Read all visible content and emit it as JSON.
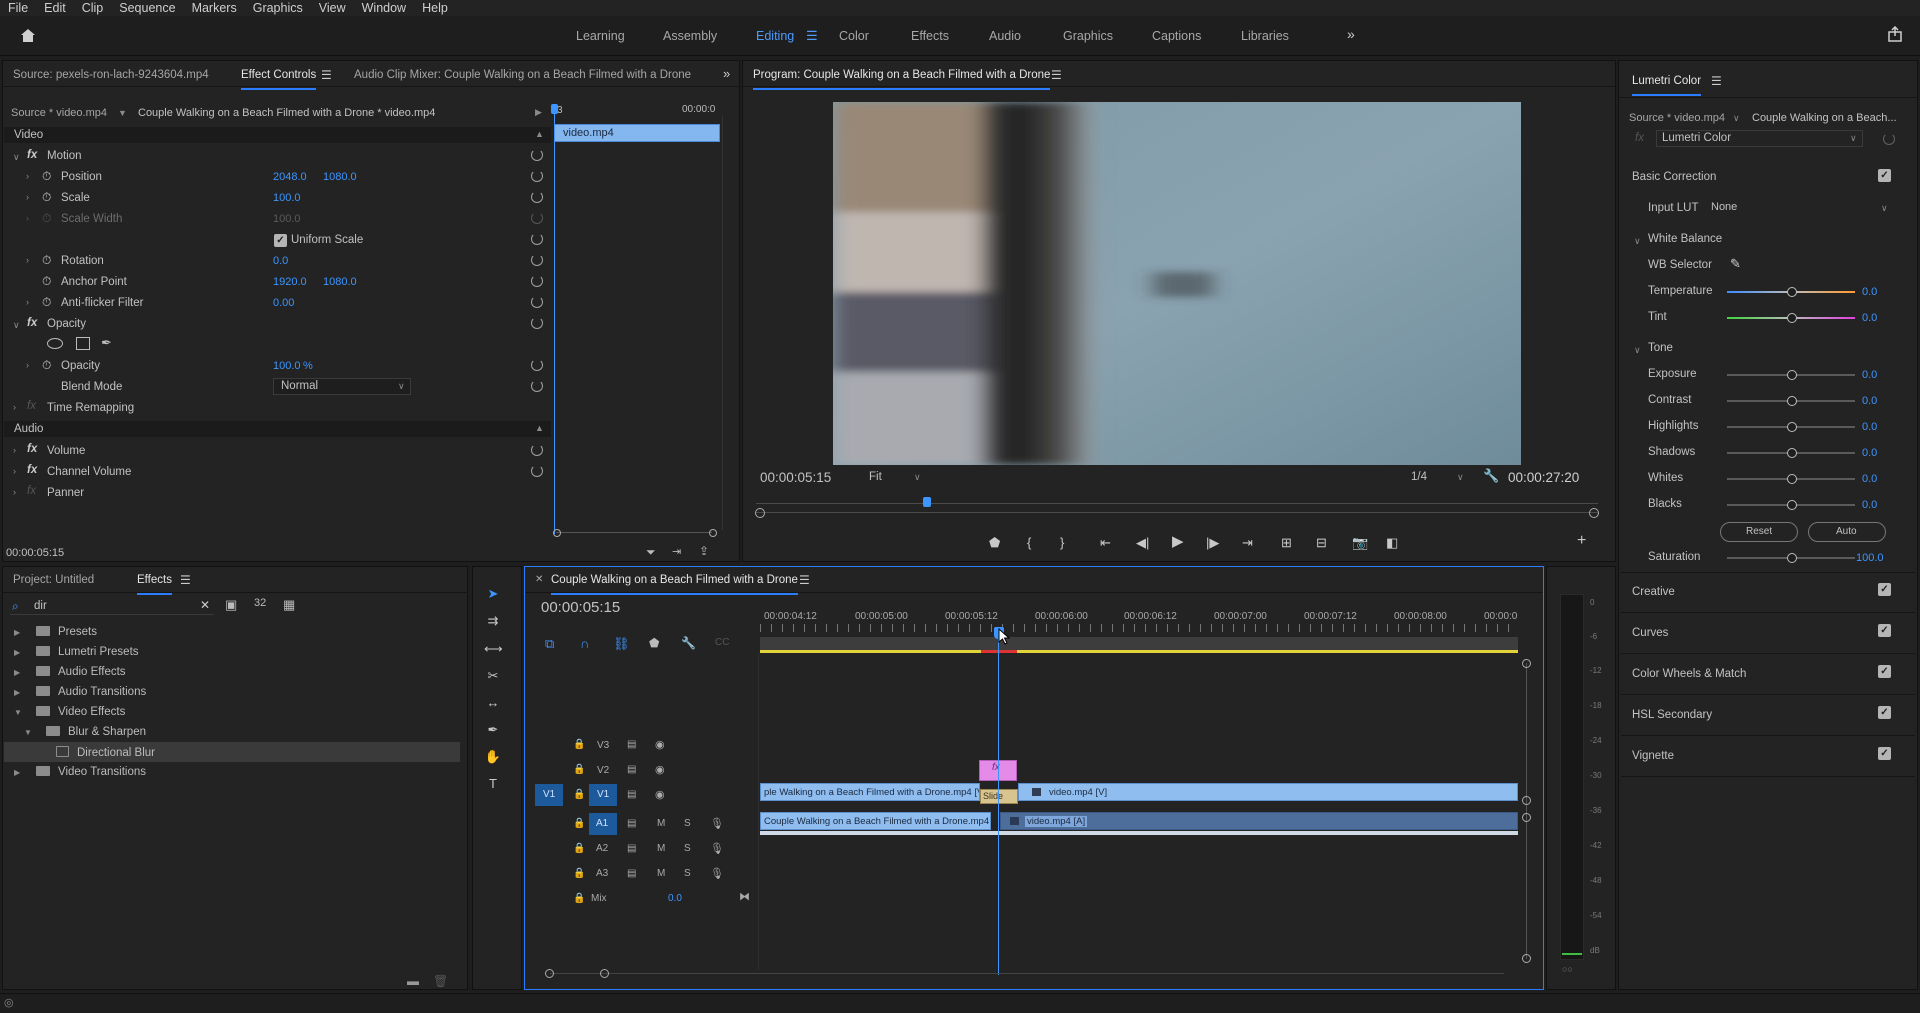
{
  "menu": [
    "File",
    "Edit",
    "Clip",
    "Sequence",
    "Markers",
    "Graphics",
    "View",
    "Window",
    "Help"
  ],
  "workspaces": [
    "Learning",
    "Assembly",
    "Editing",
    "Color",
    "Effects",
    "Audio",
    "Graphics",
    "Captions",
    "Libraries"
  ],
  "source_panel": {
    "source_tab": "Source: pexels-ron-lach-9243604.mp4",
    "effect_controls_tab": "Effect Controls",
    "audio_mixer_tab": "Audio Clip Mixer: Couple Walking on a Beach Filmed with a Drone",
    "source_path": "Source * video.mp4",
    "sequence_path": "Couple Walking on a Beach Filmed with a Drone * video.mp4",
    "mini_time": "00:00:0",
    "mini_clip": "video.mp4",
    "mini_start": "3",
    "timecode": "00:00:05:15"
  },
  "effects": {
    "video_header": "Video",
    "motion": "Motion",
    "position_label": "Position",
    "position_x": "2048.0",
    "position_y": "1080.0",
    "scale_label": "Scale",
    "scale_val": "100.0",
    "scale_width_label": "Scale Width",
    "scale_width_val": "100.0",
    "uniform_label": "Uniform Scale",
    "rotation_label": "Rotation",
    "rotation_val": "0.0",
    "anchor_label": "Anchor Point",
    "anchor_x": "1920.0",
    "anchor_y": "1080.0",
    "flicker_label": "Anti-flicker Filter",
    "flicker_val": "0.00",
    "opacity_header": "Opacity",
    "opacity_label": "Opacity",
    "opacity_val": "100.0",
    "opacity_unit": "%",
    "blend_label": "Blend Mode",
    "blend_val": "Normal",
    "time_remap": "Time Remapping",
    "audio_header": "Audio",
    "volume": "Volume",
    "channel_volume": "Channel Volume",
    "panner": "Panner"
  },
  "program": {
    "title": "Program: Couple Walking on a Beach Filmed with a Drone",
    "timecode": "00:00:05:15",
    "fit": "Fit",
    "resolution": "1/4",
    "duration": "00:00:27:20"
  },
  "lumetri": {
    "title": "Lumetri Color",
    "source": "Source * video.mp4",
    "sequence": "Couple Walking on a Beach...",
    "effect": "Lumetri Color",
    "basic": "Basic Correction",
    "input_lut_label": "Input LUT",
    "input_lut_val": "None",
    "white_balance": "White Balance",
    "wb_selector": "WB Selector",
    "temperature": "Temperature",
    "temperature_val": "0.0",
    "tint": "Tint",
    "tint_val": "0.0",
    "tone": "Tone",
    "exposure": "Exposure",
    "exposure_val": "0.0",
    "contrast": "Contrast",
    "contrast_val": "0.0",
    "highlights": "Highlights",
    "highlights_val": "0.0",
    "shadows": "Shadows",
    "shadows_val": "0.0",
    "whites": "Whites",
    "whites_val": "0.0",
    "blacks": "Blacks",
    "blacks_val": "0.0",
    "reset": "Reset",
    "auto": "Auto",
    "saturation": "Saturation",
    "saturation_val": "100.0",
    "creative": "Creative",
    "curves": "Curves",
    "color_wheels": "Color Wheels & Match",
    "hsl": "HSL Secondary",
    "vignette": "Vignette"
  },
  "project": {
    "project_tab": "Project: Untitled",
    "effects_tab": "Effects",
    "search": "dir",
    "items": [
      "Presets",
      "Lumetri Presets",
      "Audio Effects",
      "Audio Transitions",
      "Video Effects",
      "Blur & Sharpen",
      "Directional Blur",
      "Video Transitions"
    ]
  },
  "timeline": {
    "title": "Couple Walking on a Beach Filmed with a Drone",
    "timecode": "00:00:05:15",
    "ruler": [
      "00:00:04:12",
      "00:00:05:00",
      "00:00:05:12",
      "00:00:06:00",
      "00:00:06:12",
      "00:00:07:00",
      "00:00:07:12",
      "00:00:08:00",
      "00:00:0"
    ],
    "tracks_video": [
      "V3",
      "V2",
      "V1"
    ],
    "tracks_audio": [
      "A1",
      "A2",
      "A3"
    ],
    "source_v": "V1",
    "source_a": "A1",
    "mix_label": "Mix",
    "mix_val": "0.0",
    "clip_v1_a": "ple Walking on a Beach Filmed with a Drone.mp4 [V]",
    "clip_v1_b": "video.mp4 [V]",
    "clip_a1_a": "Couple Walking on a Beach Filmed with a Drone.mp4 [A]",
    "clip_a1_b": "video.mp4 [A]",
    "transition": "Slide",
    "fx_badge": "fx"
  },
  "meter": {
    "labels": [
      "0",
      "-6",
      "-12",
      "-18",
      "-24",
      "-30",
      "-36",
      "-42",
      "-48",
      "-54",
      "dB"
    ]
  }
}
